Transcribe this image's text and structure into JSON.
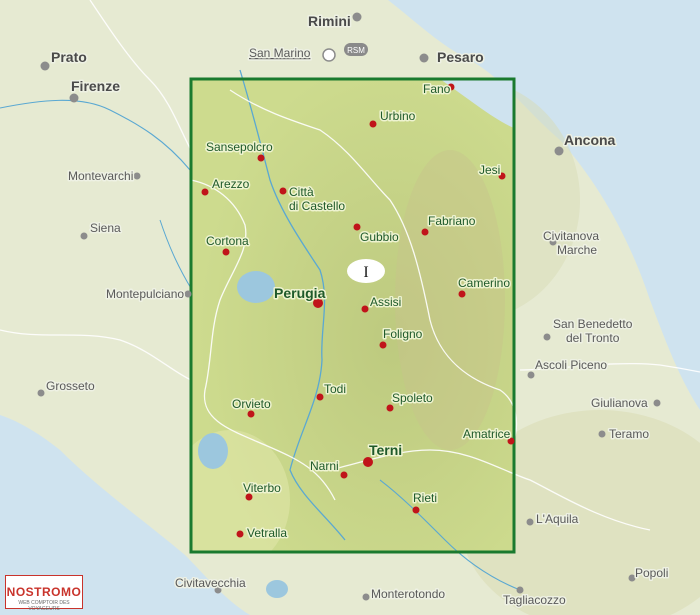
{
  "map": {
    "sheet_label": "I",
    "towns_inside": [
      {
        "name": "Fano"
      },
      {
        "name": "Urbino"
      },
      {
        "name": "Sansepolcro"
      },
      {
        "name": "Arezzo"
      },
      {
        "name": "Città"
      },
      {
        "name": "di Castello"
      },
      {
        "name": "Gubbio"
      },
      {
        "name": "Fabriano"
      },
      {
        "name": "Jesi"
      },
      {
        "name": "Cortona"
      },
      {
        "name": "Perugia"
      },
      {
        "name": "Assisi"
      },
      {
        "name": "Camerino"
      },
      {
        "name": "Foligno"
      },
      {
        "name": "Orvieto"
      },
      {
        "name": "Todi"
      },
      {
        "name": "Spoleto"
      },
      {
        "name": "Amatrice"
      },
      {
        "name": "Terni"
      },
      {
        "name": "Narni"
      },
      {
        "name": "Viterbo"
      },
      {
        "name": "Rieti"
      },
      {
        "name": "Vetralla"
      }
    ],
    "towns_outside": [
      {
        "name": "Rimini"
      },
      {
        "name": "San Marino"
      },
      {
        "name": "Pesaro"
      },
      {
        "name": "Prato"
      },
      {
        "name": "Firenze"
      },
      {
        "name": "Ancona"
      },
      {
        "name": "Montevarchi"
      },
      {
        "name": "Siena"
      },
      {
        "name": "Civitanova"
      },
      {
        "name": "Marche"
      },
      {
        "name": "Montepulciano"
      },
      {
        "name": "San Benedetto"
      },
      {
        "name": "del Tronto"
      },
      {
        "name": "Ascoli Piceno"
      },
      {
        "name": "Grosseto"
      },
      {
        "name": "Giulianova"
      },
      {
        "name": "Teramo"
      },
      {
        "name": "L'Aquila"
      },
      {
        "name": "Civitavecchia"
      },
      {
        "name": "Popoli"
      },
      {
        "name": "Monterotondo"
      },
      {
        "name": "Tagliacozzo"
      }
    ],
    "rsm_badge": "RSM"
  },
  "logo": {
    "brand": "NOSTROMO",
    "tagline": "WEB COMPTOIR DES VOYAGEURS"
  },
  "colors": {
    "sea": "#cfe3ef",
    "land_outside": "#e6ead2",
    "land_inside": "#cddb8e",
    "frame": "#1a7a2e",
    "town_dot_inside": "#c0141a",
    "town_dot_outside": "#8c8c8c",
    "lake": "#9cc7de"
  }
}
